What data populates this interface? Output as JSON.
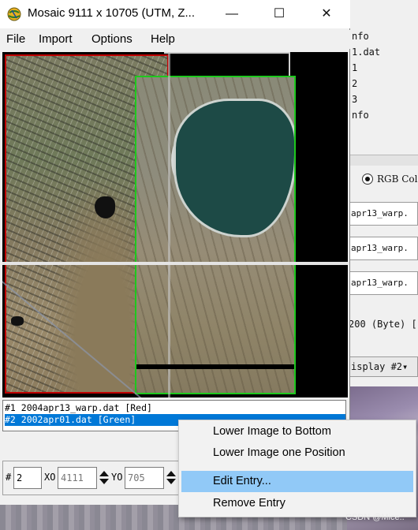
{
  "window": {
    "title": "Mosaic 9111 x 10705 (UTM, Z...",
    "minimize_glyph": "—",
    "maximize_glyph": "☐",
    "close_glyph": "✕"
  },
  "menu": {
    "file": "File",
    "import": "Import",
    "options": "Options",
    "help": "Help"
  },
  "image_list": {
    "entries": [
      {
        "label": "#1 2004apr13_warp.dat [Red]"
      },
      {
        "label": "#2 2002apr01.dat [Green]"
      }
    ],
    "selected_index": 1
  },
  "controls": {
    "entry_label": "#",
    "entry_value": "2",
    "x0_label": "XO",
    "x0_value": "4111",
    "y0_label": "YO",
    "y0_value": "705"
  },
  "context_menu": {
    "items": [
      {
        "label": "Lower Image to Bottom"
      },
      {
        "label": "Lower Image one Position"
      },
      {
        "label": "Edit Entry..."
      },
      {
        "label": "Remove Entry"
      }
    ],
    "highlighted_index": 2
  },
  "background_window": {
    "lines": [
      "nfo",
      "1.dat",
      "1",
      "2",
      "3",
      "nfo"
    ],
    "rgb_label": "RGB Col",
    "fields": [
      "apr13_warp.",
      "apr13_warp.",
      "apr13_warp."
    ],
    "byte_line": "200 (Byte) [",
    "display": "isplay #2▾"
  },
  "watermark": "CSDN @Mice..",
  "colors": {
    "red_outline": "#c00000",
    "green_outline": "#1ec81e",
    "selection": "#0078d7",
    "menu_highlight": "#91c9f7"
  }
}
